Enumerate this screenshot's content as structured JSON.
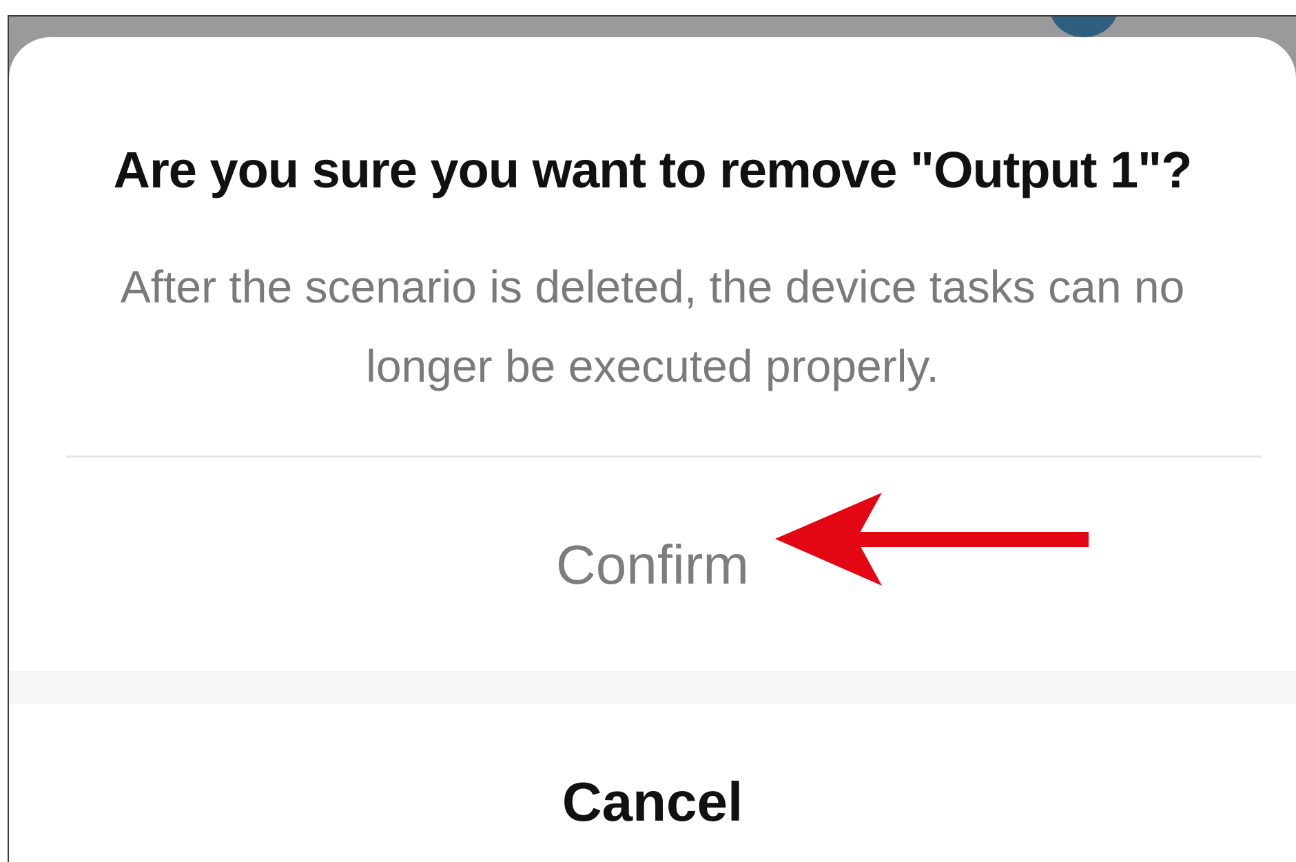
{
  "dialog": {
    "title": "Are you sure you want to remove \"Output 1\"?",
    "message": "After the scenario is deleted, the device tasks can no longer be executed properly.",
    "confirm_label": "Confirm",
    "cancel_label": "Cancel"
  },
  "annotation": {
    "icon": "red-arrow-icon",
    "color": "#e30613"
  },
  "colors": {
    "title": "#111111",
    "message": "#7a7a7a",
    "confirm": "#7d7d7d",
    "cancel": "#111111",
    "backdrop": "#9a9a9a"
  }
}
